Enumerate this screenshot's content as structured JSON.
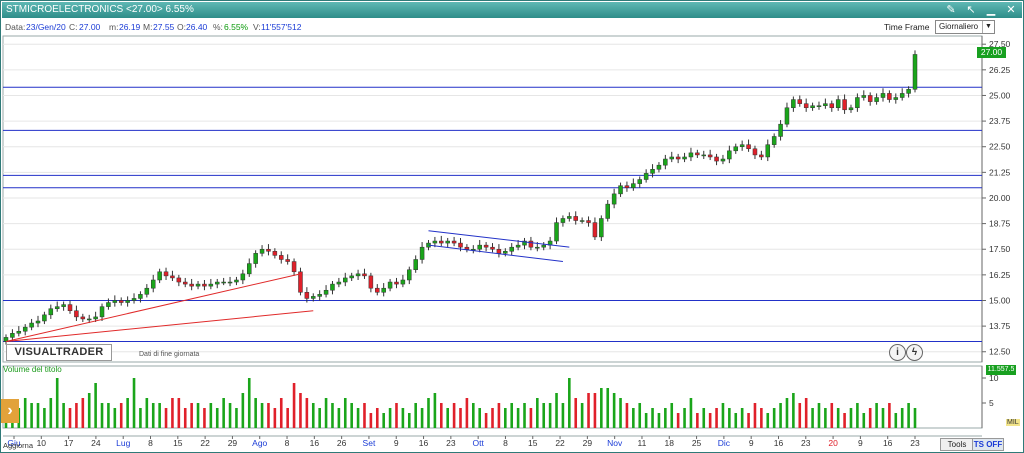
{
  "window": {
    "title": "STMICROELECTRONICS <27.00> 6.55%"
  },
  "info": {
    "data_label": "Data:",
    "data_value": "23/Gen/20",
    "c_label": "C:",
    "c_value": "27.00",
    "m_label": "m:",
    "m_value": "26.19",
    "mx_label": "M:",
    "mx_value": "27.55",
    "o_label": "O:",
    "o_value": "26.40",
    "pct_label": "%:",
    "pct_value": "6.55%",
    "v_label": "V:",
    "v_value": "11'557'512"
  },
  "timeframe": {
    "label": "Time Frame",
    "selected": "Giornaliero"
  },
  "price_axis": [
    "27.50",
    "26.25",
    "25.00",
    "23.75",
    "22.50",
    "21.25",
    "20.00",
    "18.75",
    "17.50",
    "16.25",
    "15.00",
    "13.75",
    "12.50"
  ],
  "last_price_badge": "27.00",
  "last_volume_badge": "11.557.5",
  "volume_axis": [
    "10",
    "5"
  ],
  "volume_label": "Volume del titolo",
  "logo": "VISUALTRADER",
  "eod_note": "Dati di fine giornata",
  "info_btn": "i",
  "lightning_btn": "ϟ",
  "x_labels": [
    {
      "t": "Giu",
      "m": true
    },
    {
      "t": "10",
      "m": false
    },
    {
      "t": "17",
      "m": false
    },
    {
      "t": "24",
      "m": false
    },
    {
      "t": "Lug",
      "m": true
    },
    {
      "t": "8",
      "m": false
    },
    {
      "t": "15",
      "m": false
    },
    {
      "t": "22",
      "m": false
    },
    {
      "t": "29",
      "m": false
    },
    {
      "t": "Ago",
      "m": true
    },
    {
      "t": "8",
      "m": false
    },
    {
      "t": "16",
      "m": false
    },
    {
      "t": "26",
      "m": false
    },
    {
      "t": "Set",
      "m": true
    },
    {
      "t": "9",
      "m": false
    },
    {
      "t": "16",
      "m": false
    },
    {
      "t": "23",
      "m": false
    },
    {
      "t": "Ott",
      "m": true
    },
    {
      "t": "8",
      "m": false
    },
    {
      "t": "15",
      "m": false
    },
    {
      "t": "22",
      "m": false
    },
    {
      "t": "29",
      "m": false
    },
    {
      "t": "Nov",
      "m": true
    },
    {
      "t": "11",
      "m": false
    },
    {
      "t": "18",
      "m": false
    },
    {
      "t": "25",
      "m": false
    },
    {
      "t": "Dic",
      "m": true
    },
    {
      "t": "9",
      "m": false
    },
    {
      "t": "16",
      "m": false
    },
    {
      "t": "23",
      "m": false
    },
    {
      "t": "20",
      "m": "red"
    },
    {
      "t": "9",
      "m": false
    },
    {
      "t": "16",
      "m": false
    },
    {
      "t": "23",
      "m": false
    }
  ],
  "colors": {
    "up": "#1aa51a",
    "down": "#e0202a",
    "support": "#2231c8",
    "trend": "#e02a2a",
    "channel": "#2231c8"
  },
  "bottom": {
    "aggiorna": "Aggiorna",
    "tools": "Tools",
    "ts_off": "TS OFF",
    "mil": "MIL"
  },
  "chart_data": {
    "type": "candlestick",
    "title": "STMICROELECTRONICS <27.00> 6.55%",
    "ylim": [
      12.0,
      27.9
    ],
    "support_levels": [
      25.4,
      23.3,
      21.1,
      20.5,
      15.0,
      13.0
    ],
    "close": [
      13.2,
      13.4,
      13.5,
      13.7,
      13.9,
      14.0,
      14.3,
      14.6,
      14.7,
      14.8,
      14.5,
      14.2,
      14.1,
      14.1,
      14.2,
      14.7,
      14.9,
      15.0,
      14.9,
      15.0,
      15.1,
      15.3,
      15.6,
      16.0,
      16.4,
      16.2,
      16.1,
      15.9,
      15.8,
      15.7,
      15.8,
      15.7,
      15.8,
      15.9,
      15.9,
      15.9,
      16.0,
      16.3,
      16.8,
      17.3,
      17.5,
      17.4,
      17.2,
      17.0,
      16.9,
      16.4,
      15.4,
      15.1,
      15.2,
      15.3,
      15.5,
      15.8,
      15.9,
      16.1,
      16.2,
      16.3,
      16.2,
      15.6,
      15.4,
      15.6,
      15.9,
      15.8,
      16.0,
      16.5,
      17.0,
      17.6,
      17.8,
      17.9,
      17.8,
      17.9,
      17.8,
      17.6,
      17.5,
      17.5,
      17.7,
      17.6,
      17.5,
      17.3,
      17.4,
      17.6,
      17.7,
      17.9,
      17.6,
      17.6,
      17.7,
      17.9,
      18.8,
      19.0,
      19.1,
      18.9,
      18.9,
      18.8,
      18.1,
      19.0,
      19.7,
      20.2,
      20.6,
      20.5,
      20.7,
      20.9,
      21.2,
      21.4,
      21.6,
      21.9,
      22.0,
      21.9,
      22.0,
      22.2,
      22.1,
      22.1,
      22.0,
      21.8,
      21.9,
      22.3,
      22.5,
      22.6,
      22.4,
      22.1,
      22.0,
      22.6,
      23.0,
      23.6,
      24.4,
      24.8,
      24.6,
      24.4,
      24.5,
      24.5,
      24.6,
      24.4,
      24.8,
      24.3,
      24.4,
      24.9,
      25.0,
      24.7,
      24.9,
      25.1,
      24.8,
      24.9,
      25.1,
      25.3,
      27.0
    ],
    "volume": [
      5,
      4,
      4,
      6,
      5,
      5,
      4,
      6,
      10,
      5,
      4,
      5,
      6,
      7,
      9,
      5,
      5,
      4,
      5,
      6,
      10,
      4,
      6,
      5,
      5,
      4,
      6,
      6,
      4,
      5,
      5,
      4,
      5,
      4,
      6,
      5,
      4,
      7,
      10,
      6,
      5,
      5,
      4,
      6,
      4,
      9,
      7,
      6,
      5,
      4,
      6,
      5,
      4,
      6,
      5,
      4,
      5,
      3,
      4,
      3,
      4,
      5,
      4,
      3,
      5,
      4,
      6,
      7,
      5,
      4,
      5,
      4,
      6,
      5,
      4,
      3,
      4,
      5,
      4,
      5,
      4,
      5,
      4,
      6,
      5,
      5,
      7,
      5,
      10,
      6,
      5,
      7,
      7,
      8,
      8,
      7,
      6,
      5,
      4,
      5,
      3,
      4,
      3,
      4,
      5,
      3,
      4,
      6,
      3,
      4,
      3,
      4,
      5,
      4,
      3,
      4,
      3,
      5,
      4,
      3,
      4,
      5,
      6,
      7,
      5,
      6,
      4,
      5,
      4,
      5,
      4,
      3,
      4,
      5,
      3,
      4,
      5,
      4,
      5,
      3,
      4,
      5,
      4,
      3,
      12
    ]
  }
}
